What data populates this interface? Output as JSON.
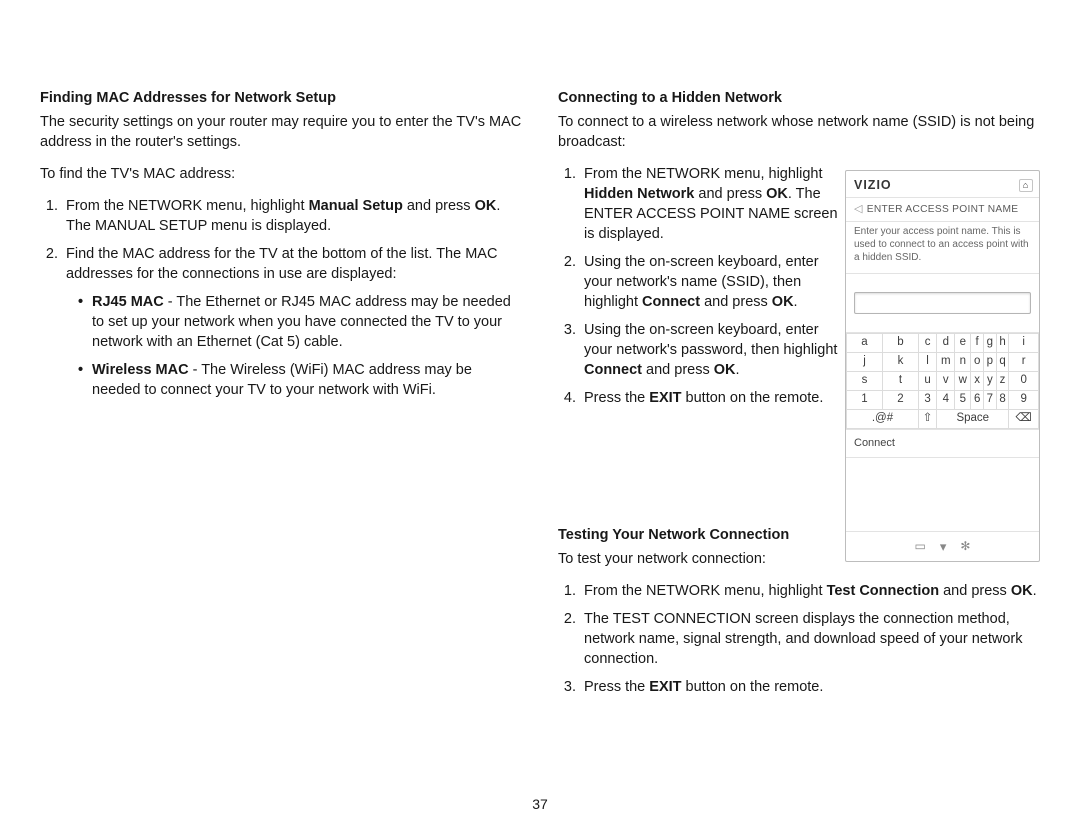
{
  "page_number": "37",
  "left": {
    "heading": "Finding MAC Addresses for Network Setup",
    "intro_1": "The security settings on your router may require you to enter the TV's MAC address in the router's settings.",
    "intro_2": "To find the TV's MAC address:",
    "step1_a": "From the NETWORK menu, highlight ",
    "step1_b_bold": "Manual Setup",
    "step1_c": " and press ",
    "step1_d_bold": "OK",
    "step1_e": ". The MANUAL SETUP menu is displayed.",
    "step2": "Find the MAC address for the TV at the bottom of the list. The MAC addresses for the connections in use are displayed:",
    "bullet1_a_bold": "RJ45 MAC",
    "bullet1_b": " - The Ethernet or RJ45 MAC address may be needed to set up your network when you have connected the TV to your network with an Ethernet (Cat 5) cable.",
    "bullet2_a_bold": "Wireless MAC",
    "bullet2_b": " - The Wireless (WiFi) MAC address may be needed to connect your TV to your network with WiFi."
  },
  "right": {
    "hidden": {
      "heading": "Connecting to a Hidden Network",
      "intro": "To connect to a wireless network whose network name (SSID) is not being broadcast:",
      "s1_a": "From the NETWORK menu, highlight ",
      "s1_b_bold": "Hidden Network",
      "s1_c": " and press ",
      "s1_d_bold": "OK",
      "s1_e": ". The ENTER ACCESS POINT NAME screen is displayed.",
      "s2_a": "Using the on-screen keyboard, enter your network's name (SSID), then highlight ",
      "s2_b_bold": "Connect",
      "s2_c": " and press ",
      "s2_d_bold": "OK",
      "s2_e": ".",
      "s3_a": "Using the on-screen keyboard, enter your network's password, then highlight ",
      "s3_b_bold": "Connect",
      "s3_c": " and press ",
      "s3_d_bold": "OK",
      "s3_e": ".",
      "s4_a": "Press the ",
      "s4_b_bold": "EXIT",
      "s4_c": " button on the remote."
    },
    "test": {
      "heading": "Testing Your Network Connection",
      "intro": "To test your network connection:",
      "s1_a": "From the NETWORK menu, highlight ",
      "s1_b_bold": "Test Connection",
      "s1_c": " and press ",
      "s1_d_bold": "OK",
      "s1_e": ".",
      "s2": "The TEST CONNECTION screen displays the connection method, network name, signal strength, and download speed of your network connection.",
      "s3_a": "Press the ",
      "s3_b_bold": "EXIT",
      "s3_c": " button on the remote."
    }
  },
  "vizio": {
    "brand": "VIZIO",
    "title": "ENTER ACCESS POINT NAME",
    "hint": "Enter your access point name. This is used to connect to an access point with a hidden SSID.",
    "kb_rows": [
      [
        "a",
        "b",
        "c",
        "d",
        "e",
        "f",
        "g",
        "h",
        "i"
      ],
      [
        "j",
        "k",
        "l",
        "m",
        "n",
        "o",
        "p",
        "q",
        "r"
      ],
      [
        "s",
        "t",
        "u",
        "v",
        "w",
        "x",
        "y",
        "z",
        "0"
      ],
      [
        "1",
        "2",
        "3",
        "4",
        "5",
        "6",
        "7",
        "8",
        "9"
      ]
    ],
    "sym": ".@#",
    "shift": "⇧",
    "space": "Space",
    "backspace": "⌫",
    "connect": "Connect"
  }
}
